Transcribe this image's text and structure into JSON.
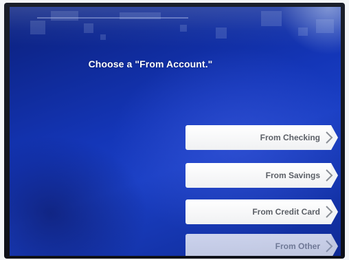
{
  "screen": {
    "prompt": "Choose a \"From Account.\""
  },
  "options": [
    {
      "label": "From Checking"
    },
    {
      "label": "From Savings"
    },
    {
      "label": "From Credit Card"
    },
    {
      "label": "From Other"
    }
  ],
  "colors": {
    "background_blue": "#1436b8",
    "button_white": "#ffffff",
    "button_text": "#5b5f66",
    "prompt_text": "#ffffff"
  },
  "icons": {
    "option_arrow": "chevron-right-icon"
  }
}
